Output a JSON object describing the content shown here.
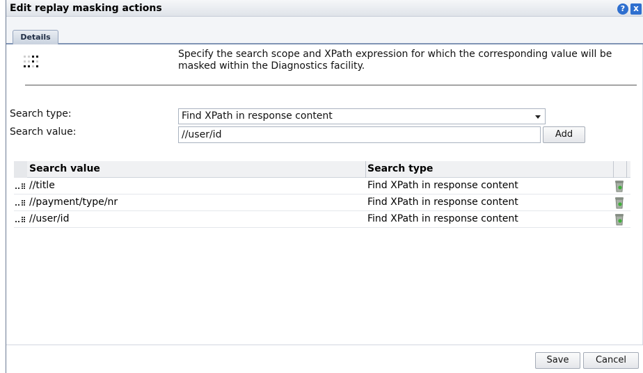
{
  "dialog": {
    "title": "Edit replay masking actions",
    "help_label": "?",
    "close_label": "x"
  },
  "tabs": [
    {
      "label": "Details"
    }
  ],
  "intro": {
    "icon": "drag-dots-icon",
    "text": "Specify the search scope and XPath expression for which the corresponding value will be masked within the Diagnostics facility."
  },
  "form": {
    "search_type_label": "Search type:",
    "search_type_value": "Find XPath in response content",
    "search_value_label": "Search value:",
    "search_value": "//user/id",
    "add_label": "Add"
  },
  "table": {
    "columns": [
      "Search value",
      "Search type"
    ],
    "rows": [
      {
        "search_value": "//title",
        "search_type": "Find XPath in response content"
      },
      {
        "search_value": "//payment/type/nr",
        "search_type": "Find XPath in response content"
      },
      {
        "search_value": "//user/id",
        "search_type": "Find XPath in response content"
      }
    ]
  },
  "footer": {
    "save_label": "Save",
    "cancel_label": "Cancel"
  },
  "colors": {
    "accent": "#2e6fcf",
    "tab_border": "#7f93b4"
  }
}
